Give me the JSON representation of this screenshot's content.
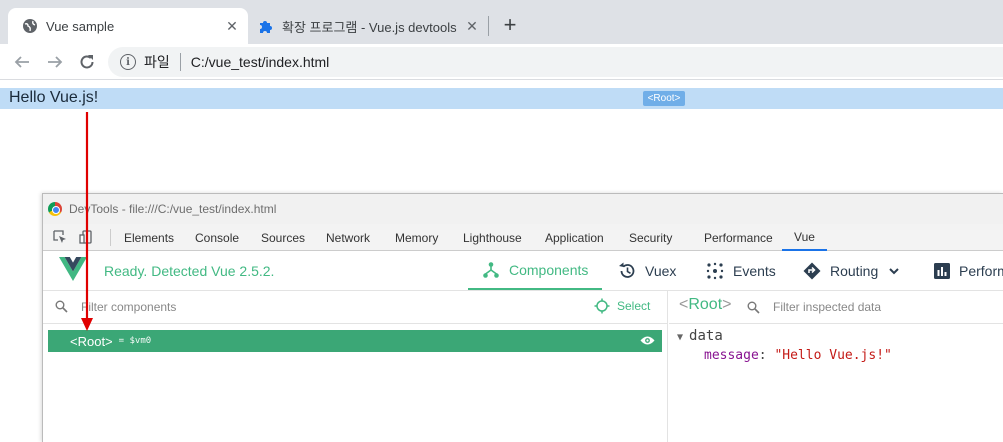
{
  "browser": {
    "tabs": [
      {
        "title": "Vue sample",
        "active": true
      },
      {
        "title": "확장 프로그램 - Vue.js devtools",
        "active": false
      }
    ],
    "address": {
      "scheme_label": "파일",
      "url": "C:/vue_test/index.html"
    }
  },
  "page": {
    "hello_text": "Hello Vue.js!",
    "root_overlay": "<Root>"
  },
  "devtools": {
    "window_title": "DevTools - file:///C:/vue_test/index.html",
    "tabs": [
      "Elements",
      "Console",
      "Sources",
      "Network",
      "Memory",
      "Lighthouse",
      "Application",
      "Security",
      "Performance",
      "Vue"
    ],
    "selected_tab": "Vue",
    "vue": {
      "status": "Ready. Detected Vue 2.5.2.",
      "nav": [
        "Components",
        "Vuex",
        "Events",
        "Routing",
        "Perform"
      ],
      "selected_nav": "Components",
      "filter_placeholder": "Filter components",
      "select_label": "Select",
      "tree": [
        {
          "name": "<Root>",
          "vm": "= $vm0"
        }
      ],
      "inspected": {
        "component": "Root",
        "filter_placeholder": "Filter inspected data"
      },
      "data_section": "data",
      "data": [
        {
          "key": "message",
          "value": "\"Hello Vue.js!\""
        }
      ]
    }
  },
  "colors": {
    "vue_green": "#42b983",
    "row_green": "#3ba776",
    "highlight": "#bfdcf6",
    "annotation_arrow": "#e00000"
  }
}
